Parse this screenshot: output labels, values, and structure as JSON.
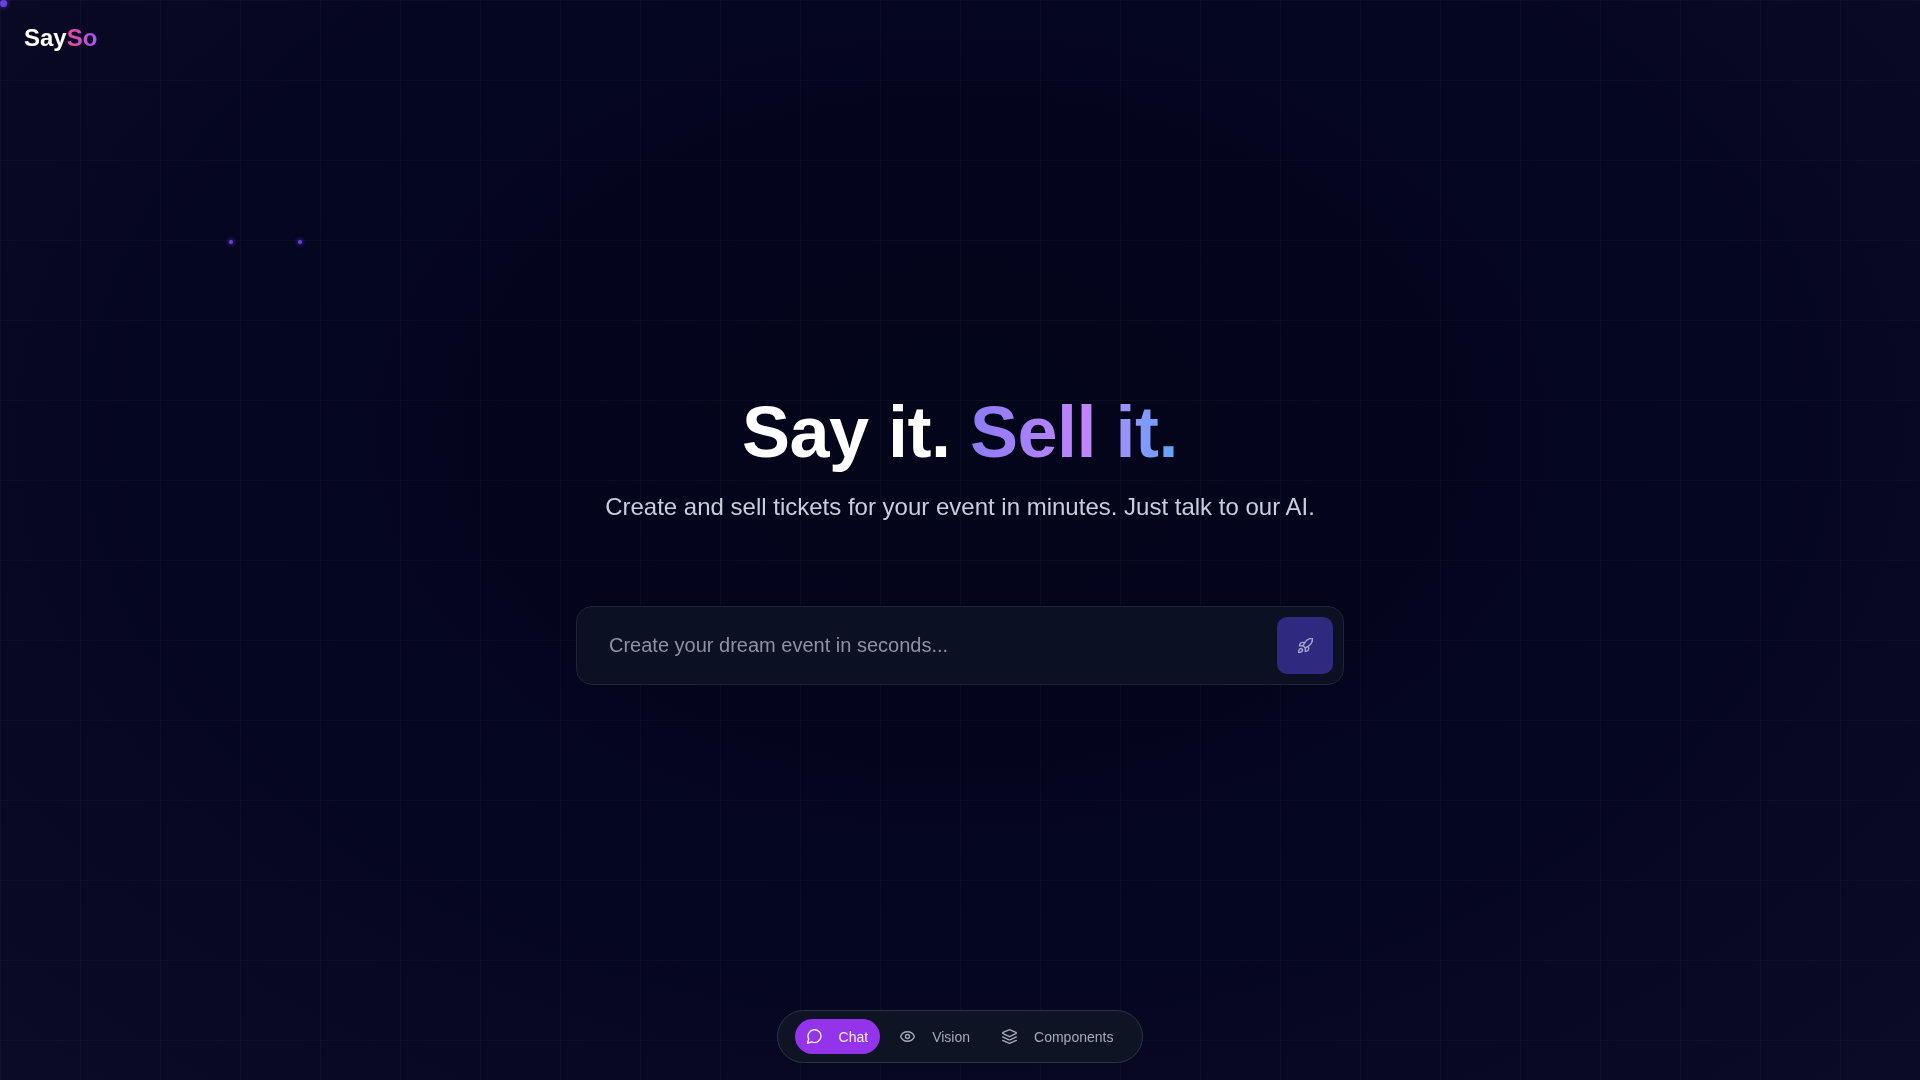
{
  "logo": [
    {
      "text": "Say",
      "kind": "plain"
    },
    {
      "text": "So",
      "kind": "accent"
    }
  ],
  "hero": {
    "title": [
      {
        "text": "Say it.",
        "kind": "plain"
      },
      {
        "text": "Sell it.",
        "kind": "accent"
      }
    ],
    "subtitle": "Create and sell tickets for your event in minutes. Just talk to our AI."
  },
  "prompt": {
    "placeholder": "Create your dream event in seconds..."
  },
  "mode_tabs": [
    {
      "label": "Chat",
      "kind": "chat",
      "selected": true
    },
    {
      "label": "Vision",
      "kind": "vision",
      "selected": false
    },
    {
      "label": "Components",
      "kind": "components",
      "selected": false
    }
  ]
}
